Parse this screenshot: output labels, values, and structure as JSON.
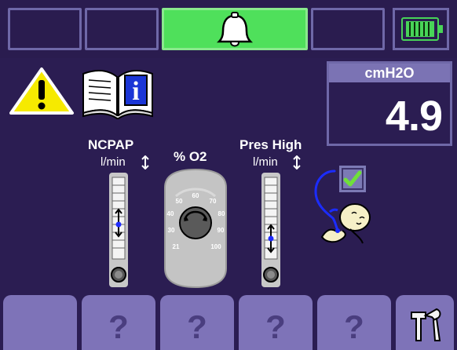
{
  "topbar": {
    "buttons": [
      {
        "label": "",
        "state": "empty"
      },
      {
        "label": "",
        "state": "empty"
      },
      {
        "label": "",
        "state": "alarm",
        "icon": "bell-icon",
        "color": "#4fe05b"
      },
      {
        "label": "",
        "state": "empty"
      },
      {
        "label": "",
        "state": "battery",
        "icon": "battery-icon"
      }
    ]
  },
  "measurement": {
    "unit": "cmH2O",
    "value": "4.9"
  },
  "icons": {
    "warning": "warning-icon",
    "manual": "info-book-icon",
    "check": "check-icon",
    "infant": "infant-icon",
    "tool": "tools-icon"
  },
  "controls": {
    "ncpap": {
      "title": "NCPAP",
      "unit": "l/min"
    },
    "oxygen": {
      "title": "% O2",
      "ticks": [
        "21",
        "30",
        "40",
        "50",
        "60",
        "70",
        "80",
        "90",
        "100"
      ]
    },
    "pres_high": {
      "title": "Pres High",
      "unit": "l/min"
    }
  },
  "bottom_buttons": [
    {
      "label": "",
      "icon": "empty"
    },
    {
      "label": "?",
      "icon": "question-icon"
    },
    {
      "label": "?",
      "icon": "question-icon"
    },
    {
      "label": "?",
      "icon": "question-icon"
    },
    {
      "label": "?",
      "icon": "question-icon"
    },
    {
      "label": "",
      "icon": "tools-icon"
    }
  ],
  "colors": {
    "background": "#2b1d52",
    "panel_border": "#6f68a8",
    "accent_green": "#4fe05b",
    "button_purple": "#7e73b8",
    "check_green": "#6fe03a"
  }
}
